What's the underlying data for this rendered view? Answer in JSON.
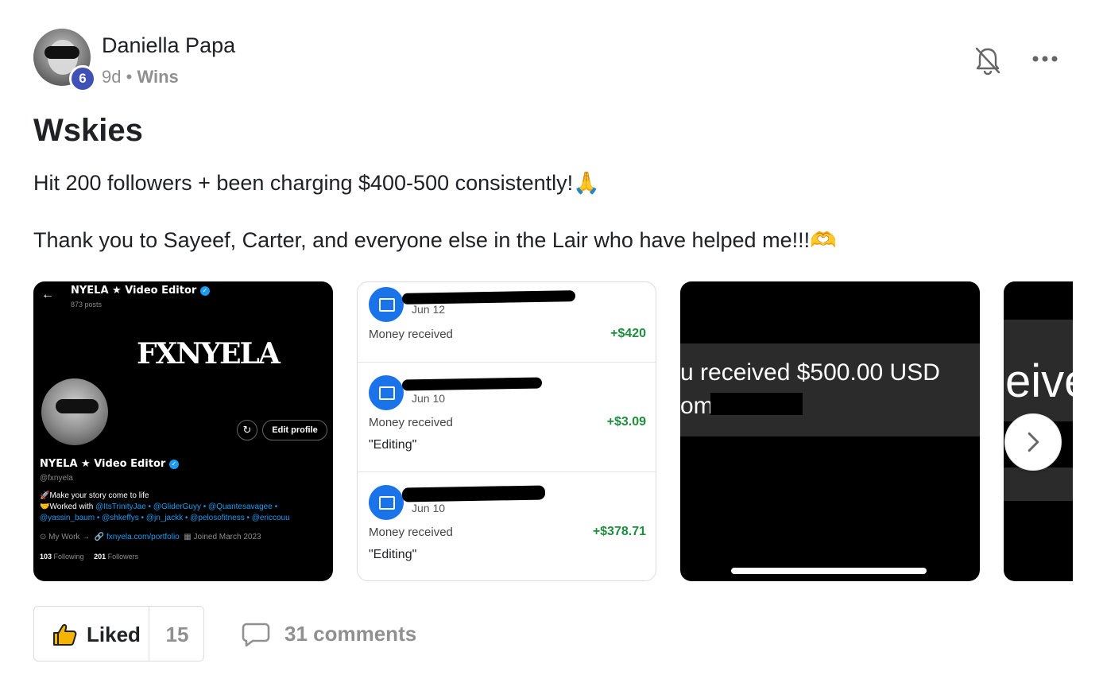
{
  "post": {
    "author": "Daniella Papa",
    "level": "6",
    "age": "9d",
    "separator": "•",
    "category": "Wins",
    "title": "Wskies",
    "line1": "Hit 200 followers + been charging $400-500 consistently!🙏",
    "line2": "Thank you to Sayeef, Carter, and everyone else in the Lair who have helped me!!!🫶"
  },
  "icons": [
    "bell-off-icon",
    "more-horizontal-icon",
    "thumbs-up-icon",
    "comment-icon",
    "chevron-right-icon"
  ],
  "gallery": {
    "profile": {
      "name": "NYELA ★ Video Editor",
      "posts": "873 posts",
      "logo": "FXNYELA",
      "edit": "Edit profile",
      "handle": "@fxnyela",
      "bio1": "🚀Make your story come to life",
      "bio2_prefix": "🤝Worked with ",
      "bio2_links": "@ItsTrinityJae • @GliderGuyy • @Quantesavagee •",
      "bio3_links": "@yassin_baum • @shkeffys • @jn_jackk • @pelosofitness • @ericcouu",
      "location": "My Work →",
      "website": "fxnyela.com/portfolio",
      "joined": "Joined March 2023",
      "following_count": "103",
      "following_label": "Following",
      "followers_count": "201",
      "followers_label": "Followers"
    },
    "payments": [
      {
        "date": "Jun 12",
        "label": "Money received",
        "amount": "+$420",
        "note": ""
      },
      {
        "date": "Jun 10",
        "label": "Money received",
        "amount": "+$3.09",
        "note": "\"Editing\""
      },
      {
        "date": "Jun 10",
        "label": "Money received",
        "amount": "+$378.71",
        "note": "\"Editing\""
      }
    ],
    "notice": {
      "line1": "u received $500.00 USD",
      "line2": "om"
    },
    "partial": "eive"
  },
  "footer": {
    "liked_label": "Liked",
    "like_count": "15",
    "comments_label": "31 comments"
  },
  "colors": {
    "level_badge": "#3f51b5",
    "amount_green": "#1e8e3e",
    "twitter_blue": "#1d9bf0",
    "muted": "#909090"
  }
}
